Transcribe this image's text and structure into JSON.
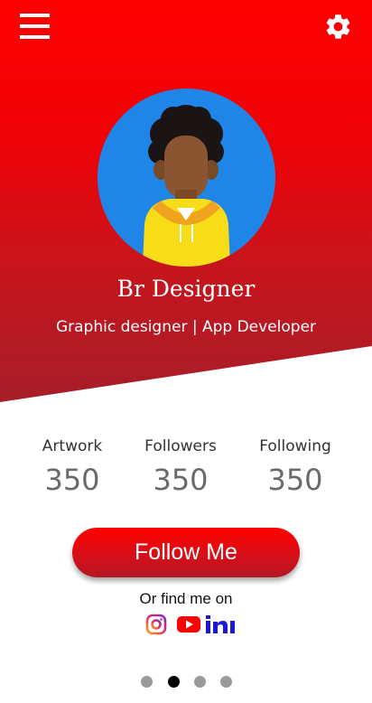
{
  "profile": {
    "name": "Br Designer",
    "role": "Graphic designer | App Developer"
  },
  "toolbar": {
    "menu_icon": "hamburger-menu-icon",
    "settings_icon": "gear-icon"
  },
  "stats": [
    {
      "label": "Artwork",
      "value": "350"
    },
    {
      "label": "Followers",
      "value": "350"
    },
    {
      "label": "Following",
      "value": "350"
    }
  ],
  "actions": {
    "follow_label": "Follow Me",
    "find_label": "Or find me on"
  },
  "socials": [
    "instagram-icon",
    "youtube-icon",
    "linkedin-icon"
  ],
  "pager": {
    "count": 4,
    "active_index": 1
  },
  "colors": {
    "brand_red": "#ff0000",
    "dark_red": "#a51e2a",
    "avatar_bg": "#1f86e8"
  }
}
